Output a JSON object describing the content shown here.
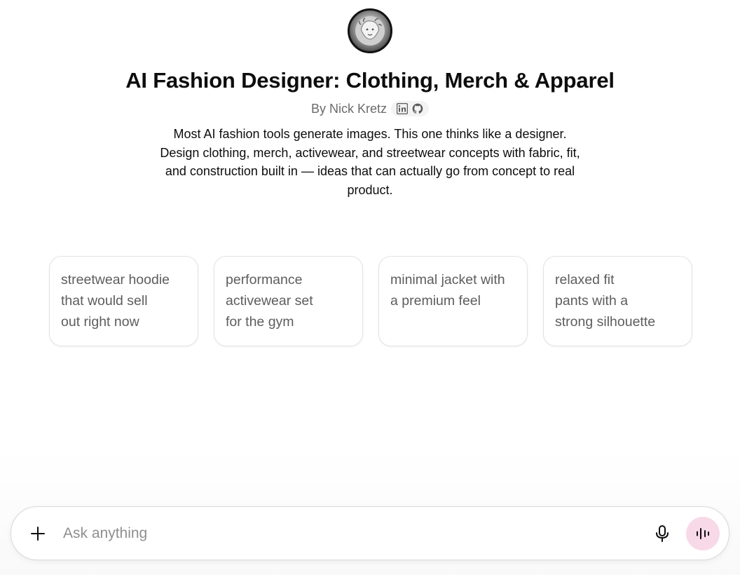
{
  "gpt": {
    "avatar_icon": "medusa-head-logo",
    "title": "AI Fashion Designer: Clothing, Merch & Apparel",
    "byline": "By Nick Kretz",
    "social_icons": [
      "linkedin-icon",
      "github-icon"
    ],
    "description": "Most AI fashion tools generate images. This one thinks like a designer. Design clothing, merch, activewear, and streetwear concepts with fabric, fit, and construction built in — ideas that can actually go from concept to real product."
  },
  "suggestions": [
    {
      "lines": [
        "streetwear hoodie",
        "that would sell",
        "out right now"
      ]
    },
    {
      "lines": [
        "performance",
        "activewear set",
        "for the gym"
      ]
    },
    {
      "lines": [
        "minimal jacket with",
        "a premium feel"
      ]
    },
    {
      "lines": [
        "relaxed fit",
        "pants with a",
        "strong silhouette"
      ]
    }
  ],
  "composer": {
    "placeholder": "Ask anything",
    "attach_icon": "plus-icon",
    "mic_icon": "microphone-icon",
    "voice_icon": "voice-waveform-icon",
    "voice_button_color": "#f8d9e8"
  }
}
